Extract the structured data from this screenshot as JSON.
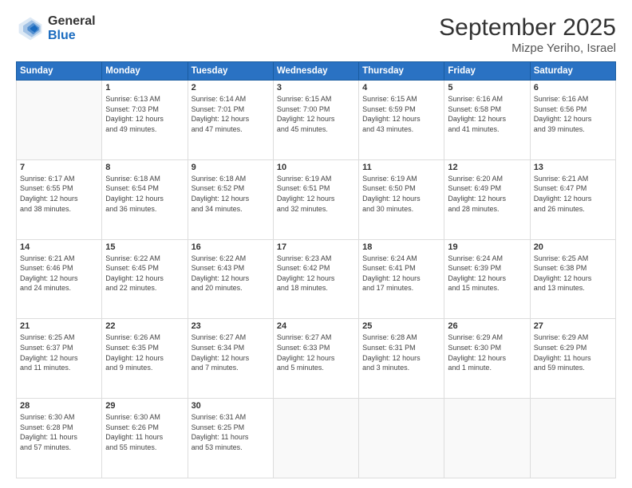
{
  "header": {
    "logo_general": "General",
    "logo_blue": "Blue",
    "title": "September 2025",
    "location": "Mizpe Yeriho, Israel"
  },
  "days_of_week": [
    "Sunday",
    "Monday",
    "Tuesday",
    "Wednesday",
    "Thursday",
    "Friday",
    "Saturday"
  ],
  "weeks": [
    [
      {
        "day": "",
        "info": ""
      },
      {
        "day": "1",
        "info": "Sunrise: 6:13 AM\nSunset: 7:03 PM\nDaylight: 12 hours\nand 49 minutes."
      },
      {
        "day": "2",
        "info": "Sunrise: 6:14 AM\nSunset: 7:01 PM\nDaylight: 12 hours\nand 47 minutes."
      },
      {
        "day": "3",
        "info": "Sunrise: 6:15 AM\nSunset: 7:00 PM\nDaylight: 12 hours\nand 45 minutes."
      },
      {
        "day": "4",
        "info": "Sunrise: 6:15 AM\nSunset: 6:59 PM\nDaylight: 12 hours\nand 43 minutes."
      },
      {
        "day": "5",
        "info": "Sunrise: 6:16 AM\nSunset: 6:58 PM\nDaylight: 12 hours\nand 41 minutes."
      },
      {
        "day": "6",
        "info": "Sunrise: 6:16 AM\nSunset: 6:56 PM\nDaylight: 12 hours\nand 39 minutes."
      }
    ],
    [
      {
        "day": "7",
        "info": "Sunrise: 6:17 AM\nSunset: 6:55 PM\nDaylight: 12 hours\nand 38 minutes."
      },
      {
        "day": "8",
        "info": "Sunrise: 6:18 AM\nSunset: 6:54 PM\nDaylight: 12 hours\nand 36 minutes."
      },
      {
        "day": "9",
        "info": "Sunrise: 6:18 AM\nSunset: 6:52 PM\nDaylight: 12 hours\nand 34 minutes."
      },
      {
        "day": "10",
        "info": "Sunrise: 6:19 AM\nSunset: 6:51 PM\nDaylight: 12 hours\nand 32 minutes."
      },
      {
        "day": "11",
        "info": "Sunrise: 6:19 AM\nSunset: 6:50 PM\nDaylight: 12 hours\nand 30 minutes."
      },
      {
        "day": "12",
        "info": "Sunrise: 6:20 AM\nSunset: 6:49 PM\nDaylight: 12 hours\nand 28 minutes."
      },
      {
        "day": "13",
        "info": "Sunrise: 6:21 AM\nSunset: 6:47 PM\nDaylight: 12 hours\nand 26 minutes."
      }
    ],
    [
      {
        "day": "14",
        "info": "Sunrise: 6:21 AM\nSunset: 6:46 PM\nDaylight: 12 hours\nand 24 minutes."
      },
      {
        "day": "15",
        "info": "Sunrise: 6:22 AM\nSunset: 6:45 PM\nDaylight: 12 hours\nand 22 minutes."
      },
      {
        "day": "16",
        "info": "Sunrise: 6:22 AM\nSunset: 6:43 PM\nDaylight: 12 hours\nand 20 minutes."
      },
      {
        "day": "17",
        "info": "Sunrise: 6:23 AM\nSunset: 6:42 PM\nDaylight: 12 hours\nand 18 minutes."
      },
      {
        "day": "18",
        "info": "Sunrise: 6:24 AM\nSunset: 6:41 PM\nDaylight: 12 hours\nand 17 minutes."
      },
      {
        "day": "19",
        "info": "Sunrise: 6:24 AM\nSunset: 6:39 PM\nDaylight: 12 hours\nand 15 minutes."
      },
      {
        "day": "20",
        "info": "Sunrise: 6:25 AM\nSunset: 6:38 PM\nDaylight: 12 hours\nand 13 minutes."
      }
    ],
    [
      {
        "day": "21",
        "info": "Sunrise: 6:25 AM\nSunset: 6:37 PM\nDaylight: 12 hours\nand 11 minutes."
      },
      {
        "day": "22",
        "info": "Sunrise: 6:26 AM\nSunset: 6:35 PM\nDaylight: 12 hours\nand 9 minutes."
      },
      {
        "day": "23",
        "info": "Sunrise: 6:27 AM\nSunset: 6:34 PM\nDaylight: 12 hours\nand 7 minutes."
      },
      {
        "day": "24",
        "info": "Sunrise: 6:27 AM\nSunset: 6:33 PM\nDaylight: 12 hours\nand 5 minutes."
      },
      {
        "day": "25",
        "info": "Sunrise: 6:28 AM\nSunset: 6:31 PM\nDaylight: 12 hours\nand 3 minutes."
      },
      {
        "day": "26",
        "info": "Sunrise: 6:29 AM\nSunset: 6:30 PM\nDaylight: 12 hours\nand 1 minute."
      },
      {
        "day": "27",
        "info": "Sunrise: 6:29 AM\nSunset: 6:29 PM\nDaylight: 11 hours\nand 59 minutes."
      }
    ],
    [
      {
        "day": "28",
        "info": "Sunrise: 6:30 AM\nSunset: 6:28 PM\nDaylight: 11 hours\nand 57 minutes."
      },
      {
        "day": "29",
        "info": "Sunrise: 6:30 AM\nSunset: 6:26 PM\nDaylight: 11 hours\nand 55 minutes."
      },
      {
        "day": "30",
        "info": "Sunrise: 6:31 AM\nSunset: 6:25 PM\nDaylight: 11 hours\nand 53 minutes."
      },
      {
        "day": "",
        "info": ""
      },
      {
        "day": "",
        "info": ""
      },
      {
        "day": "",
        "info": ""
      },
      {
        "day": "",
        "info": ""
      }
    ]
  ]
}
